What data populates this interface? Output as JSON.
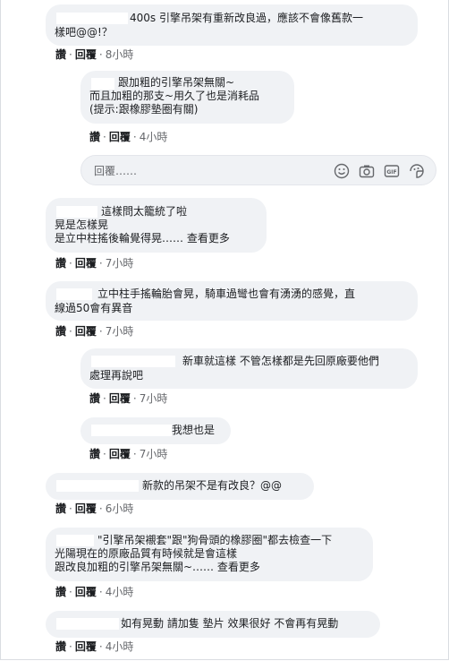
{
  "comments": [
    {
      "lines": [
        "400s 引擎吊架有重新改良過，應該不會像舊款一",
        "樣吧@@!？"
      ],
      "actions": {
        "like": "讚",
        "reply": "回覆",
        "time": "8小時"
      }
    },
    {
      "lines": [
        "跟加粗的引擎吊架無關~",
        "而且加粗的那支~用久了也是消耗品",
        "(提示:跟橡膠墊圈有關)"
      ],
      "actions": {
        "like": "讚",
        "reply": "回覆",
        "time": "4小時"
      }
    },
    {
      "lines": [
        "這樣問太籠統了啦",
        "晃是怎樣晃",
        "是立中柱搖後輪覺得晃……"
      ],
      "see_more": "查看更多",
      "actions": {
        "like": "讚",
        "reply": "回覆",
        "time": "7小時"
      }
    },
    {
      "lines": [
        "立中柱手搖輪胎會晃，騎車過彎也會有湧湧的感覺，直",
        "線過50會有異音"
      ],
      "actions": {
        "like": "讚",
        "reply": "回覆",
        "time": "7小時"
      }
    },
    {
      "lines": [
        "新車就這樣 不管怎樣都是先回原廠要他們",
        "處理再說吧"
      ],
      "actions": {
        "like": "讚",
        "reply": "回覆",
        "time": "7小時"
      }
    },
    {
      "lines": [
        "我想也是"
      ],
      "actions": {
        "like": "讚",
        "reply": "回覆",
        "time": "7小時"
      }
    },
    {
      "lines": [
        "新款的吊架不是有改良？@@"
      ],
      "actions": {
        "like": "讚",
        "reply": "回覆",
        "time": "6小時"
      }
    },
    {
      "lines": [
        "\"引擎吊架襯套\"跟\"狗骨頭的橡膠圈\"都去檢查一下",
        "光陽現在的原廠品質有時候就是會這樣",
        "跟改良加粗的引擎吊架無關~……"
      ],
      "see_more": "查看更多",
      "actions": {
        "like": "讚",
        "reply": "回覆",
        "time": "4小時"
      }
    },
    {
      "lines": [
        "如有晃動 請加隻 墊片 效果很好 不會再有晃動"
      ],
      "actions": {
        "like": "讚",
        "reply": "回覆",
        "time": "4小時"
      }
    }
  ],
  "reply_box": {
    "placeholder": "回覆……",
    "icons": [
      "emoji-icon",
      "camera-icon",
      "gif-icon",
      "sticker-icon"
    ]
  },
  "colors": {
    "bubble": "#f0f2f5",
    "meta": "#65676b",
    "text": "#1c1e21"
  }
}
